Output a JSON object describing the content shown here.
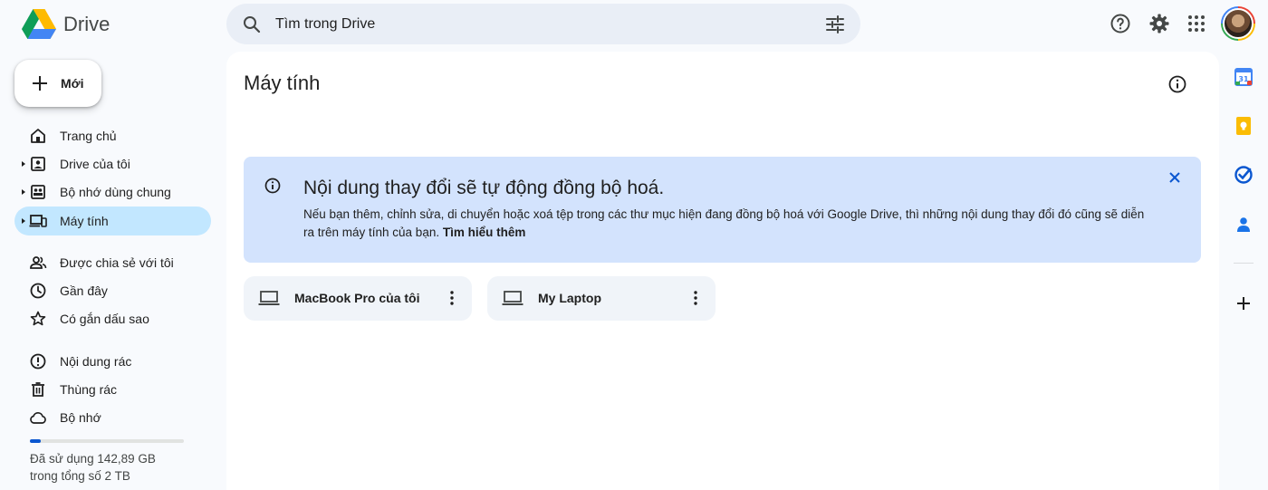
{
  "app": {
    "name": "Drive"
  },
  "search": {
    "placeholder": "Tìm trong Drive"
  },
  "sidebar": {
    "new_label": "Mới",
    "items": [
      {
        "label": "Trang chủ",
        "icon": "home-icon"
      },
      {
        "label": "Drive của tôi",
        "icon": "my-drive-icon"
      },
      {
        "label": "Bộ nhớ dùng chung",
        "icon": "shared-drives-icon"
      },
      {
        "label": "Máy tính",
        "icon": "computers-icon",
        "active": true
      },
      {
        "label": "Được chia sẻ với tôi",
        "icon": "people-icon"
      },
      {
        "label": "Gần đây",
        "icon": "clock-icon"
      },
      {
        "label": "Có gắn dấu sao",
        "icon": "star-icon"
      },
      {
        "label": "Nội dung rác",
        "icon": "spam-icon"
      },
      {
        "label": "Thùng rác",
        "icon": "trash-icon"
      },
      {
        "label": "Bộ nhớ",
        "icon": "cloud-icon"
      }
    ],
    "storage": {
      "used_fraction": 0.07,
      "line1": "Đã sử dụng 142,89 GB",
      "line2": "trong tổng số 2 TB"
    }
  },
  "main": {
    "title": "Máy tính",
    "banner": {
      "title": "Nội dung thay đổi sẽ tự động đồng bộ hoá.",
      "body": "Nếu bạn thêm, chỉnh sửa, di chuyển hoặc xoá tệp trong các thư mục hiện đang đồng bộ hoá với Google Drive, thì những nội dung thay đổi đó cũng sẽ diễn ra trên máy tính của bạn.",
      "link": "Tìm hiểu thêm"
    },
    "devices": [
      {
        "name": "MacBook Pro của tôi"
      },
      {
        "name": "My Laptop"
      }
    ]
  },
  "colors": {
    "accent": "#0b57d0",
    "active_nav": "#c2e7ff",
    "banner": "#d3e3fd",
    "search": "#e9eef6"
  }
}
